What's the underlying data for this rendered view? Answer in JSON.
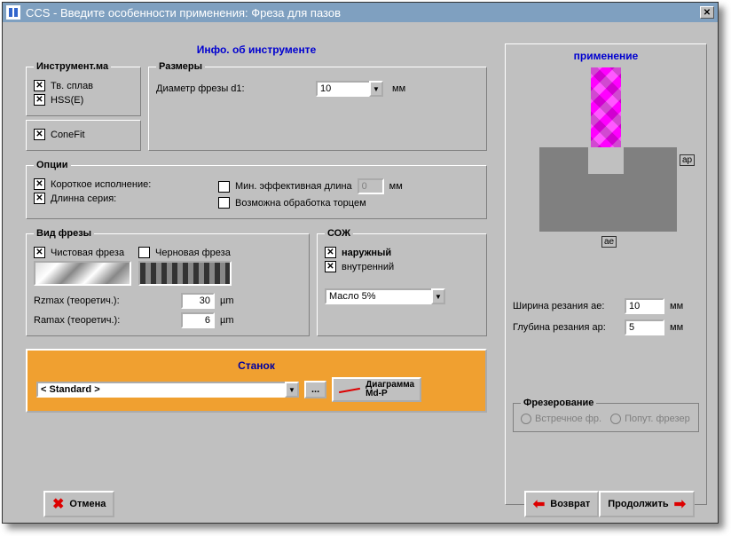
{
  "window": {
    "title": "CCS - Введите особенности применения: Фреза для пазов"
  },
  "headers": {
    "tool_info": "Инфо. об инструменте",
    "application": "применение",
    "machine": "Станок"
  },
  "tool_material": {
    "legend": "Инструмент.ма",
    "opt1": "Тв. сплав",
    "opt2": "HSS(E)",
    "opt3": "ConeFit"
  },
  "dimensions": {
    "legend": "Размеры",
    "d1_label": "Диаметр фрезы d1:",
    "d1_value": "10",
    "unit": "мм"
  },
  "options": {
    "legend": "Опции",
    "short": "Короткое исполнение:",
    "long": "Длинна серия:",
    "min_len": "Мин. эффективная длина",
    "min_len_value": "0",
    "unit": "мм",
    "face": "Возможна обработка торцем"
  },
  "mill_type": {
    "legend": "Вид фрезы",
    "finish": "Чистовая фреза",
    "rough": "Черновая фреза",
    "rzmax": "Rzmax (теоретич.):",
    "rzmax_value": "30",
    "ramax": "Ramax (теоретич.):",
    "ramax_value": "6",
    "unit": "µm"
  },
  "coolant": {
    "legend": "СОЖ",
    "external": "наружный",
    "internal": "внутренний",
    "fluid": "Масло 5%"
  },
  "machine": {
    "value": "< Standard >",
    "more": "...",
    "diagram": "Диаграмма",
    "mdp": "Md-P"
  },
  "app_params": {
    "ae_label": "Ширина резания ae:",
    "ae_value": "10",
    "ap_label": "Глубина резания ap:",
    "ap_value": "5",
    "unit": "мм",
    "dim_ap": "ap",
    "dim_ae": "ae"
  },
  "milling_dir": {
    "legend": "Фрезерование",
    "conventional": "Встречное фр.",
    "climb": "Попут. фрезер"
  },
  "buttons": {
    "cancel": "Отмена",
    "back": "Возврат",
    "continue": "Продолжить"
  }
}
